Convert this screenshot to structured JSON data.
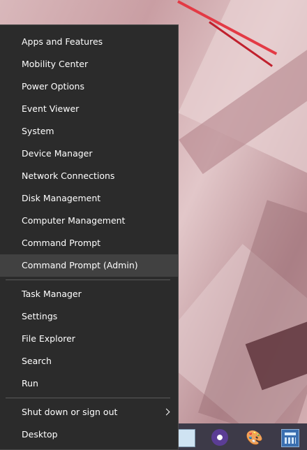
{
  "menu": {
    "items": [
      {
        "label": "Apps and Features"
      },
      {
        "label": "Mobility Center"
      },
      {
        "label": "Power Options"
      },
      {
        "label": "Event Viewer"
      },
      {
        "label": "System"
      },
      {
        "label": "Device Manager"
      },
      {
        "label": "Network Connections"
      },
      {
        "label": "Disk Management"
      },
      {
        "label": "Computer Management"
      },
      {
        "label": "Command Prompt"
      },
      {
        "label": "Command Prompt (Admin)"
      },
      {
        "label": "Task Manager"
      },
      {
        "label": "Settings"
      },
      {
        "label": "File Explorer"
      },
      {
        "label": "Search"
      },
      {
        "label": "Run"
      },
      {
        "label": "Shut down or sign out"
      },
      {
        "label": "Desktop"
      }
    ],
    "highlighted_item": "Command Prompt (Admin)",
    "colors": {
      "background": "#2b2b2b",
      "highlight": "#414141",
      "text": "#ffffff"
    }
  },
  "taskbar": {
    "icons": [
      "notepad-icon",
      "bittorrent-icon",
      "paint-icon",
      "calculator-icon"
    ]
  }
}
